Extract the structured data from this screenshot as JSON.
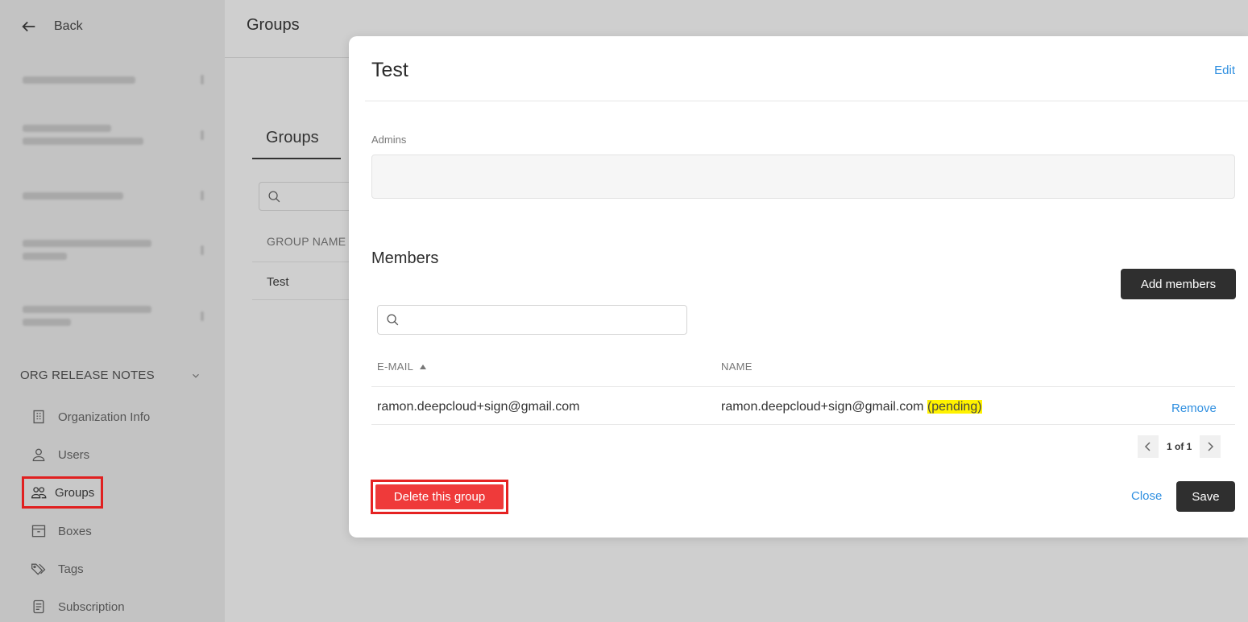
{
  "sidebar": {
    "back_label": "Back",
    "section_title": "ORG RELEASE NOTES",
    "items": [
      {
        "label": "Organization Info",
        "icon": "building-icon"
      },
      {
        "label": "Users",
        "icon": "user-icon"
      },
      {
        "label": "Groups",
        "icon": "users-group-icon"
      },
      {
        "label": "Boxes",
        "icon": "archive-box-icon"
      },
      {
        "label": "Tags",
        "icon": "tag-icon"
      },
      {
        "label": "Subscription",
        "icon": "document-icon"
      }
    ]
  },
  "main": {
    "title": "Groups",
    "tab": "Groups",
    "column_header": "GROUP NAME",
    "rows": [
      "Test"
    ]
  },
  "modal": {
    "title": "Test",
    "edit_label": "Edit",
    "admins_label": "Admins",
    "members_title": "Members",
    "add_members_label": "Add members",
    "search_placeholder": "",
    "columns": {
      "email": "E-MAIL",
      "name": "NAME"
    },
    "members": [
      {
        "email": "ramon.deepcloud+sign@gmail.com",
        "name": "ramon.deepcloud+sign@gmail.com",
        "status": "(pending)",
        "action": "Remove"
      }
    ],
    "pagination": "1 of 1",
    "delete_label": "Delete this group",
    "close_label": "Close",
    "save_label": "Save"
  },
  "colors": {
    "accent_link": "#2f8fe0",
    "danger": "#ef3a3a",
    "primary_dark": "#2f2f2f",
    "highlight": "#fff200"
  }
}
